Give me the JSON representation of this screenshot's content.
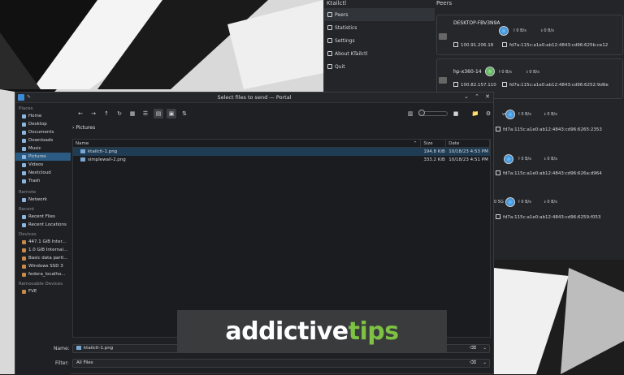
{
  "colors": {
    "accent": "#2b5a82",
    "brand_green": "#7dc242",
    "dialog_bg": "#1e2023"
  },
  "ktailctl": {
    "title": "Ktailctl",
    "peers_heading": "Peers",
    "nav": [
      {
        "label": "Peers",
        "icon": "peers-icon"
      },
      {
        "label": "Statistics",
        "icon": "statistics-icon"
      },
      {
        "label": "Settings",
        "icon": "settings-icon"
      },
      {
        "label": "About KTailctl",
        "icon": "info-icon"
      },
      {
        "label": "Quit",
        "icon": "quit-icon"
      }
    ],
    "peers": [
      {
        "name": "DESKTOP-FBV3N9A",
        "up": "0 B/s",
        "down": "0 B/s",
        "ipv4": "100.91.206.18",
        "ipv6": "fd7a:115c:a1e0:ab12:4843:cd96:625b:ce12"
      },
      {
        "name": "hp-x360-14",
        "up": "0 B/s",
        "down": "0 B/s",
        "ipv4": "100.82.157.110",
        "ipv6": "fd7a:115c:a1e0:ab12:4843:cd96:6252:9d6e"
      },
      {
        "name": "ver",
        "up": "0 B/s",
        "down": "0 B/s",
        "ipv4": "",
        "ipv6": "fd7a:115c:a1e0:ab12:4843:cd96:6265:2353"
      },
      {
        "name": "",
        "up": "0 B/s",
        "down": "0 B/s",
        "ipv4": "",
        "ipv6": "fd7a:115c:a1e0:ab12:4843:cd96:626a:d964"
      },
      {
        "name": "0 5G",
        "up": "0 B/s",
        "down": "0 B/s",
        "ipv4": "",
        "ipv6": "fd7a:115c:a1e0:ab12:4843:cd96:6259:f053"
      }
    ]
  },
  "dialog": {
    "title": "Select files to send — Portal",
    "places": {
      "heading": "Places",
      "items": [
        {
          "label": "Home",
          "icon": "home-icon"
        },
        {
          "label": "Desktop",
          "icon": "desktop-icon"
        },
        {
          "label": "Documents",
          "icon": "documents-icon"
        },
        {
          "label": "Downloads",
          "icon": "downloads-icon"
        },
        {
          "label": "Music",
          "icon": "music-icon"
        },
        {
          "label": "Pictures",
          "icon": "pictures-icon"
        },
        {
          "label": "Videos",
          "icon": "videos-icon"
        },
        {
          "label": "Nextcloud",
          "icon": "nextcloud-icon"
        },
        {
          "label": "Trash",
          "icon": "trash-icon"
        }
      ]
    },
    "remote": {
      "heading": "Remote",
      "items": [
        {
          "label": "Network",
          "icon": "network-icon"
        }
      ]
    },
    "recent": {
      "heading": "Recent",
      "items": [
        {
          "label": "Recent Files",
          "icon": "recent-files-icon"
        },
        {
          "label": "Recent Locations",
          "icon": "recent-locations-icon"
        }
      ]
    },
    "devices": {
      "heading": "Devices",
      "items": [
        {
          "label": "447.1 GiB Inter...",
          "icon": "drive-icon"
        },
        {
          "label": "1.0 GiB Internal...",
          "icon": "drive-icon"
        },
        {
          "label": "Basic data parti...",
          "icon": "drive-icon"
        },
        {
          "label": "Windows SSD 3",
          "icon": "drive-icon"
        },
        {
          "label": "fedora_localho...",
          "icon": "drive-icon"
        }
      ]
    },
    "removable": {
      "heading": "Removable Devices",
      "items": [
        {
          "label": "FVE",
          "icon": "usb-drive-icon"
        }
      ]
    },
    "breadcrumb": "Pictures",
    "columns": {
      "name": "Name",
      "size": "Size",
      "date": "Date"
    },
    "files": [
      {
        "name": "ktailctl-1.png",
        "size": "194.8 KiB",
        "date": "10/18/23 4:53 PM"
      },
      {
        "name": "simplewall-2.png",
        "size": "333.2 KiB",
        "date": "10/18/23 4:51 PM"
      }
    ],
    "name_label": "Name:",
    "name_value": "ktailctl-1.png",
    "filter_label": "Filter:",
    "filter_value": "All Files"
  },
  "banner": {
    "part1": "addictive",
    "part2": "tips"
  }
}
